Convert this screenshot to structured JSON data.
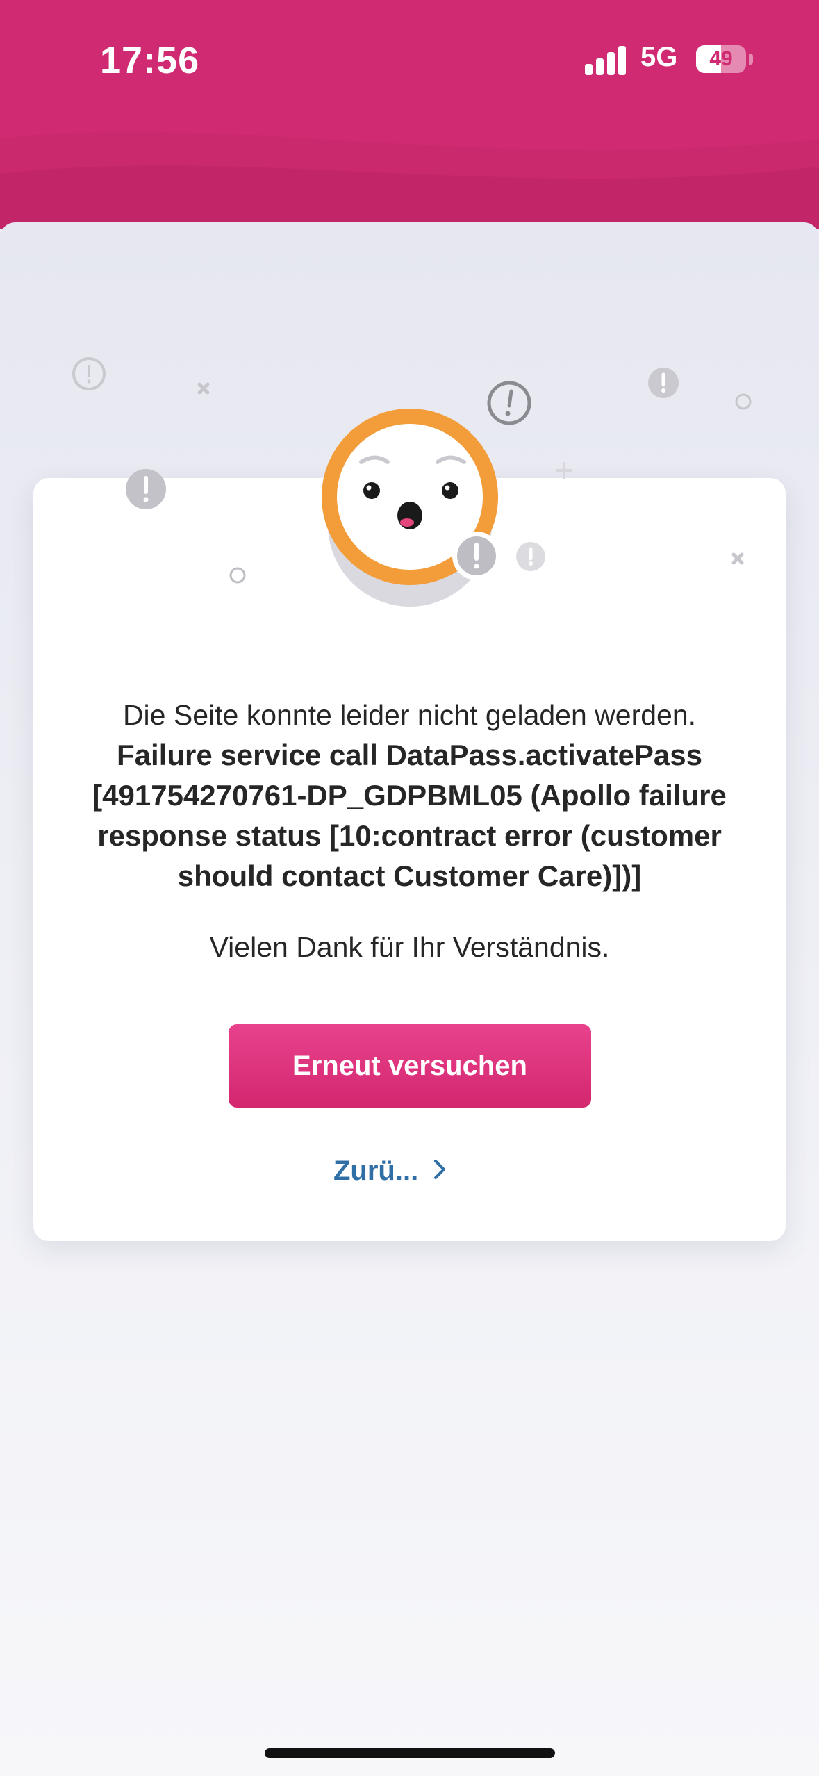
{
  "status_bar": {
    "time": "17:56",
    "network": "5G",
    "battery": "49"
  },
  "error": {
    "intro": "Die Seite konnte leider nicht geladen werden.",
    "detail": "Failure service call DataPass.activatePass [491754270761-DP_GDPBML05 (Apollo failure response status [10:contract error (customer should contact Customer Care)])]",
    "thanks": "Vielen Dank für Ihr Verständnis."
  },
  "actions": {
    "retry_label": "Erneut versuchen",
    "back_label": "Zurü..."
  },
  "colors": {
    "brand": "#d02b72",
    "link": "#2f6fa5",
    "mascot_ring": "#f39c3a"
  },
  "icons": [
    "signal-icon",
    "battery-icon",
    "surprised-face-icon",
    "exclamation-icon",
    "chevron-right-icon"
  ]
}
